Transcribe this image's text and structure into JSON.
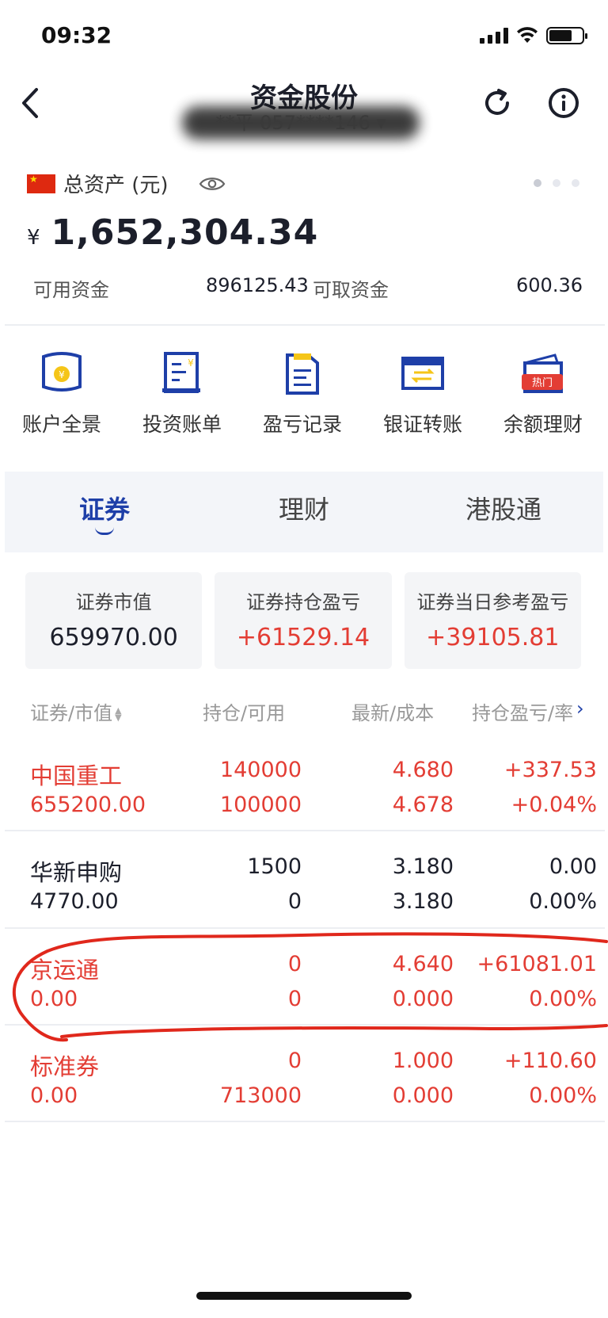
{
  "status_bar": {
    "time": "09:32"
  },
  "header": {
    "title": "资金股份",
    "account": "**平 057****146 ▾"
  },
  "assets": {
    "label": "总资产 (元)",
    "currency": "¥",
    "total": "1,652,304.34",
    "available_label": "可用资金",
    "available_value": "896125.43",
    "withdrawable_label": "可取资金",
    "withdrawable_value": "600.36"
  },
  "quick_menu": [
    {
      "label": "账户全景",
      "icon": "account-overview-icon"
    },
    {
      "label": "投资账单",
      "icon": "investment-bill-icon"
    },
    {
      "label": "盈亏记录",
      "icon": "profit-record-icon"
    },
    {
      "label": "银证转账",
      "icon": "bank-transfer-icon"
    },
    {
      "label": "余额理财",
      "icon": "balance-finance-icon",
      "badge": "热门"
    }
  ],
  "tabs": [
    {
      "label": "证券",
      "active": true
    },
    {
      "label": "理财",
      "active": false
    },
    {
      "label": "港股通",
      "active": false
    }
  ],
  "summary": [
    {
      "label": "证券市值",
      "value": "659970.00"
    },
    {
      "label": "证券持仓盈亏",
      "value": "+61529.14"
    },
    {
      "label": "证券当日参考盈亏",
      "value": "+39105.81"
    }
  ],
  "table": {
    "headers": [
      "证券/市值",
      "持仓/可用",
      "最新/成本",
      "持仓盈亏/率"
    ],
    "rows": [
      {
        "name": "中国重工",
        "market_value": "655200.00",
        "position": "140000",
        "available": "100000",
        "latest": "4.680",
        "cost": "4.678",
        "pnl": "+337.53",
        "pnl_rate": "+0.04%"
      },
      {
        "name": "华新申购",
        "market_value": "4770.00",
        "position": "1500",
        "available": "0",
        "latest": "3.180",
        "cost": "3.180",
        "pnl": "0.00",
        "pnl_rate": "0.00%"
      },
      {
        "name": "京运通",
        "market_value": "0.00",
        "position": "0",
        "available": "0",
        "latest": "4.640",
        "cost": "0.000",
        "pnl": "+61081.01",
        "pnl_rate": "0.00%"
      },
      {
        "name": "标准券",
        "market_value": "0.00",
        "position": "0",
        "available": "713000",
        "latest": "1.000",
        "cost": "0.000",
        "pnl": "+110.60",
        "pnl_rate": "0.00%"
      }
    ]
  },
  "colors": {
    "accent": "#1e3fa8",
    "up": "#e33d34",
    "annotation": "#e0281c"
  }
}
